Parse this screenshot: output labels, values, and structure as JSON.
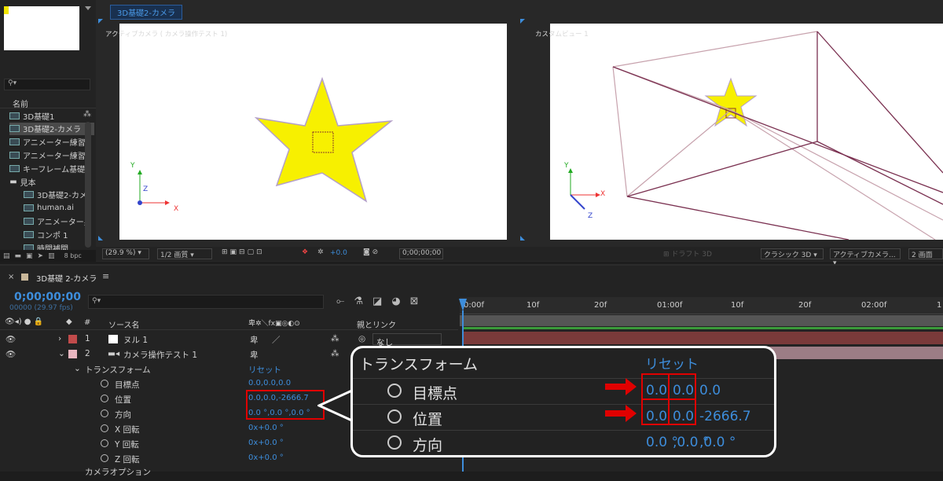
{
  "comp_tab": "3D基礎2-カメラ",
  "search_placeholder": "",
  "project": {
    "col_name": "名前",
    "items": [
      {
        "label": "3D基礎1",
        "indent": 0
      },
      {
        "label": "3D基礎2-カメラ",
        "indent": 0,
        "selected": true
      },
      {
        "label": "アニメーター練習",
        "indent": 0
      },
      {
        "label": "アニメーター練習",
        "indent": 0
      },
      {
        "label": "キーフレーム基礎",
        "indent": 0
      },
      {
        "label": "見本",
        "indent": 0,
        "folder": true
      },
      {
        "label": "3D基礎2-カメ",
        "indent": 1
      },
      {
        "label": "human.ai",
        "indent": 1
      },
      {
        "label": "アニメーター男",
        "indent": 1
      },
      {
        "label": "コンポ 1",
        "indent": 1
      },
      {
        "label": "時間補間",
        "indent": 1
      }
    ],
    "bpc": "8 bpc"
  },
  "viewer_left": {
    "label": "アクティブカメラ ( カメラ操作テスト 1)",
    "axis_x": "X",
    "axis_y": "Y",
    "axis_z": "Z"
  },
  "viewer_right": {
    "label": "カスタムビュー 1",
    "axis_x": "X",
    "axis_y": "Y",
    "axis_z": "Z"
  },
  "viewer_toolbar": {
    "zoom": "(29.9 %)",
    "resolution": "1/2 画質",
    "exposure": "+0.0",
    "timecode": "0;00;00;00",
    "draft3d": "ドラフト 3D",
    "renderer": "クラシック 3D",
    "camera": "アクティブカメラ...",
    "views": "2 画面"
  },
  "timeline": {
    "comp_name": "3D基礎 2-カメラ",
    "timecode": "0;00;00;00",
    "frame_info": "00000 (29.97 fps)",
    "col_num": "#",
    "col_source": "ソース名",
    "col_parent": "親とリンク",
    "ruler": [
      "0:00f",
      "10f",
      "20f",
      "01:00f",
      "10f",
      "20f",
      "02:00f",
      "1"
    ],
    "layers": [
      {
        "num": "1",
        "name": "ヌル 1",
        "color": "#c14b4b",
        "parent": "なし"
      },
      {
        "num": "2",
        "name": "カメラ操作テスト 1",
        "color": "#e8b6c0",
        "parent": ""
      }
    ],
    "transform_label": "トランスフォーム",
    "reset": "リセット",
    "props": [
      {
        "name": "目標点",
        "value": "0.0,0.0,0.0"
      },
      {
        "name": "位置",
        "value": "0.0,0.0,-2666.7"
      },
      {
        "name": "方向",
        "value": "0.0 °,0.0 °,0.0 °"
      },
      {
        "name": "X 回転",
        "value": "0x+0.0 °"
      },
      {
        "name": "Y 回転",
        "value": "0x+0.0 °"
      },
      {
        "name": "Z 回転",
        "value": "0x+0.0 °"
      }
    ],
    "more": "カメラオプション"
  },
  "callout": {
    "title": "トランスフォーム",
    "reset": "リセット",
    "rows": [
      {
        "name": "目標点",
        "v1": "0.0",
        "v2": "0.0",
        "v3": "0.0"
      },
      {
        "name": "位置",
        "v1": "0.0",
        "v2": "0.0",
        "v3": "-2666.7"
      },
      {
        "name": "方向",
        "v1": "0.0 °",
        "v2": ",0.0 °",
        "v3": ",0.0 °"
      }
    ]
  }
}
